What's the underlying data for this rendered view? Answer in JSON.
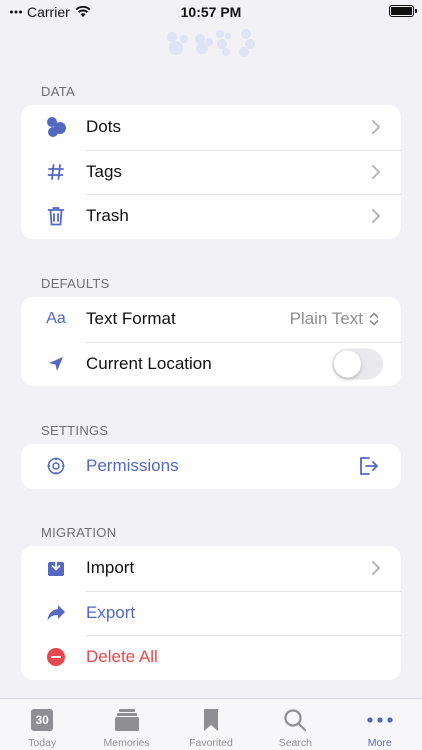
{
  "status": {
    "carrier": "Carrier",
    "time": "10:57 PM"
  },
  "sections": {
    "data": {
      "label": "DATA",
      "rows": [
        {
          "label": "Dots",
          "icon": "dots-icon"
        },
        {
          "label": "Tags",
          "icon": "hashtag-icon"
        },
        {
          "label": "Trash",
          "icon": "trash-icon"
        }
      ]
    },
    "defaults": {
      "label": "DEFAULTS",
      "text_format": {
        "label": "Text Format",
        "value": "Plain Text",
        "icon_text": "Aa"
      },
      "current_location": {
        "label": "Current Location",
        "enabled": false
      }
    },
    "settings": {
      "label": "SETTINGS",
      "permissions": {
        "label": "Permissions"
      }
    },
    "migration": {
      "label": "MIGRATION",
      "import": {
        "label": "Import"
      },
      "export": {
        "label": "Export"
      },
      "delete_all": {
        "label": "Delete All"
      }
    }
  },
  "tabbar": {
    "today": {
      "label": "Today",
      "badge": "30"
    },
    "memories": {
      "label": "Memories"
    },
    "favorited": {
      "label": "Favorited"
    },
    "search": {
      "label": "Search"
    },
    "more": {
      "label": "More"
    }
  },
  "colors": {
    "accent": "#5468c2",
    "destructive": "#e5484d",
    "background": "#f1f1f6"
  }
}
